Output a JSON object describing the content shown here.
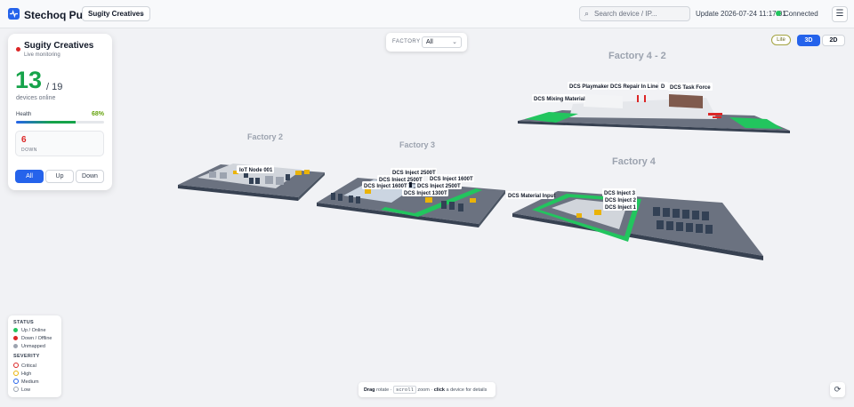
{
  "app": {
    "title": "Stechoq Pulse",
    "org_select": "Sugity Creatives",
    "search_placeholder": "Search device / IP...",
    "update_text": "Update 2026-07-24 11:17:01",
    "connection_status": "Connected",
    "menu_icon": "hamburger-icon"
  },
  "summary": {
    "org_name": "Sugity Creatives",
    "subtitle": "Live monitoring",
    "online_count": "13",
    "total": "/ 19",
    "online_label": "devices online",
    "health_label": "Health",
    "health_pct": "68%",
    "health_value": 0.68,
    "down_count": "6",
    "down_label": "DOWN",
    "filters": [
      "All",
      "Up",
      "Down"
    ],
    "active_filter": "All"
  },
  "factory_filter": {
    "label": "FACTORY",
    "value": "All"
  },
  "view_toggle": {
    "lite": "Lite",
    "mode_3d": "3D",
    "mode_2d": "2D",
    "active": "3D"
  },
  "scene": {
    "factories": [
      "Factory 2",
      "Factory 3",
      "Factory 4 - 2",
      "Factory 4"
    ],
    "device_labels": [
      "IoT Node 001",
      "DCS Inject 2500T",
      "DCS Inject 2500T",
      "DCS Inject 1600T",
      "DCS Inject 1600T",
      "DCS Inject 2500T",
      "DCS Inject 1300T",
      "DCS Material Input",
      "DCS Inject 3",
      "DCS Inject 2",
      "DCS Inject 1",
      "DCS Playmaker",
      "DCS Repair In Line",
      "DCS Task Force",
      "DCS Mixing Material",
      "D"
    ]
  },
  "legend": {
    "status_title": "STATUS",
    "status": [
      {
        "label": "Up / Online",
        "color": "#22c55e"
      },
      {
        "label": "Down / Offline",
        "color": "#dc2626"
      },
      {
        "label": "Unmapped",
        "color": "#9ca3af"
      }
    ],
    "severity_title": "SEVERITY",
    "severity": [
      {
        "label": "Critical",
        "color": "#dc2626"
      },
      {
        "label": "High",
        "color": "#eab308"
      },
      {
        "label": "Medium",
        "color": "#2563eb"
      },
      {
        "label": "Low",
        "color": "#9ca3af"
      }
    ]
  },
  "hint": {
    "drag": "Drag",
    "rotate": "rotate ·",
    "scroll": "scroll",
    "zoom": "zoom ·",
    "click": "click",
    "details": "a device for details"
  },
  "reset_icon": "reset-view-icon"
}
